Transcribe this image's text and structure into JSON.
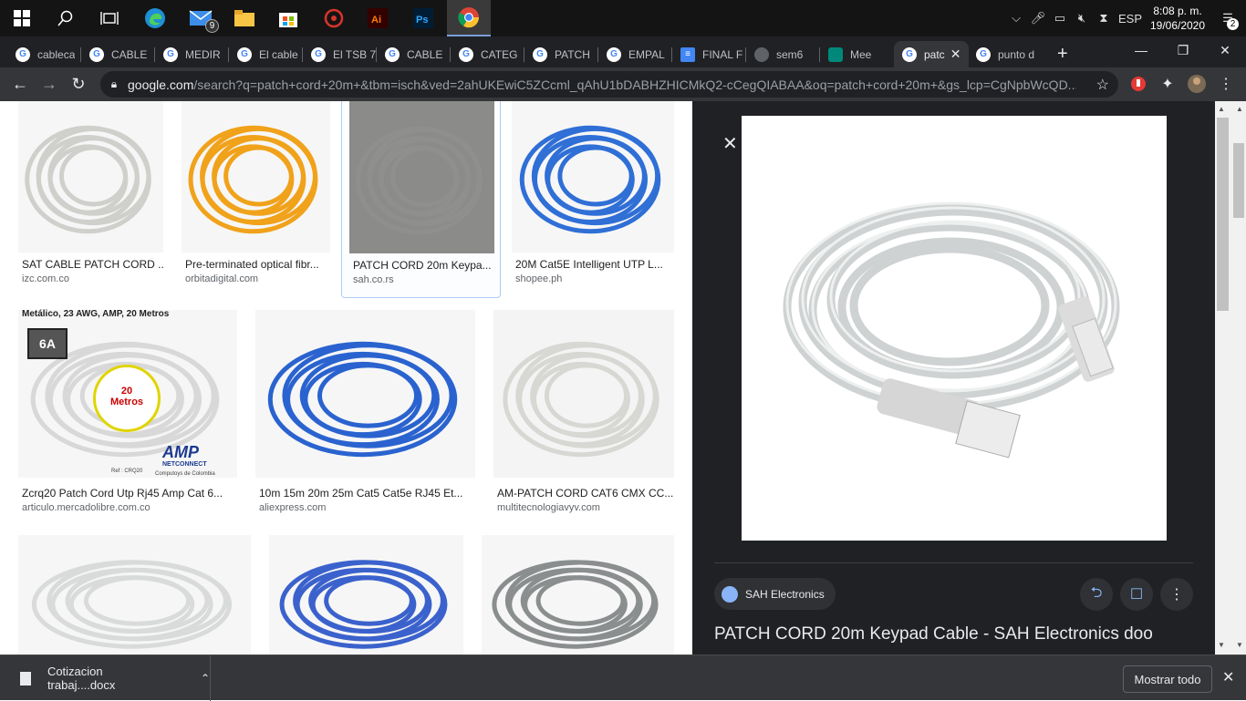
{
  "taskbar": {
    "mail_badge": "9",
    "lang": "ESP",
    "time": "8:08 p. m.",
    "date": "19/06/2020",
    "notif_count": "2"
  },
  "tabs": [
    {
      "label": "cableca",
      "fav": "g"
    },
    {
      "label": "CABLE",
      "fav": "g"
    },
    {
      "label": "MEDIR",
      "fav": "g"
    },
    {
      "label": "El cable",
      "fav": "g"
    },
    {
      "label": "El TSB 7",
      "fav": "g"
    },
    {
      "label": "CABLE",
      "fav": "g"
    },
    {
      "label": "CATEG",
      "fav": "g"
    },
    {
      "label": "PATCH",
      "fav": "g"
    },
    {
      "label": "EMPAL",
      "fav": "g"
    },
    {
      "label": "FINAL F",
      "fav": "doc"
    },
    {
      "label": "sem6",
      "fav": "globe"
    },
    {
      "label": "Mee",
      "fav": "meet"
    },
    {
      "label": "patc",
      "fav": "g"
    },
    {
      "label": "punto d",
      "fav": "g"
    }
  ],
  "omnibox": {
    "host": "google.com",
    "path": "/search?q=patch+cord+20m+&tbm=isch&ved=2ahUKEwiC5ZCcml_qAhU1bDABHZHICMkQ2-cCegQIABAA&oq=patch+cord+20m+&gs_lcp=CgNpbWcQD..."
  },
  "results": [
    {
      "title": "SAT CABLE PATCH CORD ...",
      "source": "izc.com.co",
      "color": "#cfcfcc"
    },
    {
      "title": "Pre-terminated optical fibr...",
      "source": "orbitadigital.com",
      "color": "#f0a21a"
    },
    {
      "title": "PATCH CORD 20m Keypa...",
      "source": "sah.co.rs",
      "color": "#8f8f8d"
    },
    {
      "title": "20M Cat5E Intelligent UTP L...",
      "source": "shopee.ph",
      "color": "#2f6fd6"
    },
    {
      "title": "Zcrq20 Patch Cord Utp Rj45 Amp Cat 6...",
      "source": "articulo.mercadolibre.com.co",
      "color": "#d8d8d8"
    },
    {
      "title": "10m 15m 20m 25m Cat5 Cat5e RJ45 Et...",
      "source": "aliexpress.com",
      "color": "#2a63cf"
    },
    {
      "title": "AM-PATCH CORD CAT6 CMX CC...",
      "source": "multitecnologiavyv.com",
      "color": "#d7d7d3"
    },
    {
      "title": "",
      "source": "",
      "color": "#d9dbdb"
    },
    {
      "title": "",
      "source": "",
      "color": "#3b62cc"
    },
    {
      "title": "",
      "source": "",
      "color": "#8b8e8e"
    }
  ],
  "result_overlay": {
    "line1": "Metálico, 23 AWG, AMP, 20 Metros",
    "cat": "6A",
    "meters_num": "20",
    "meters_word": "Metros",
    "brand": "AMP",
    "brand_sub": "NETCONNECT",
    "ref": "Ref : CRQ20",
    "seller": "Computoys de Colombia"
  },
  "panel": {
    "source_name": "SAH Electronics",
    "title": "PATCH CORD 20m Keypad Cable - SAH Electronics doo"
  },
  "download": {
    "filename": "Cotizacion trabaj....docx",
    "show_all": "Mostrar todo"
  }
}
